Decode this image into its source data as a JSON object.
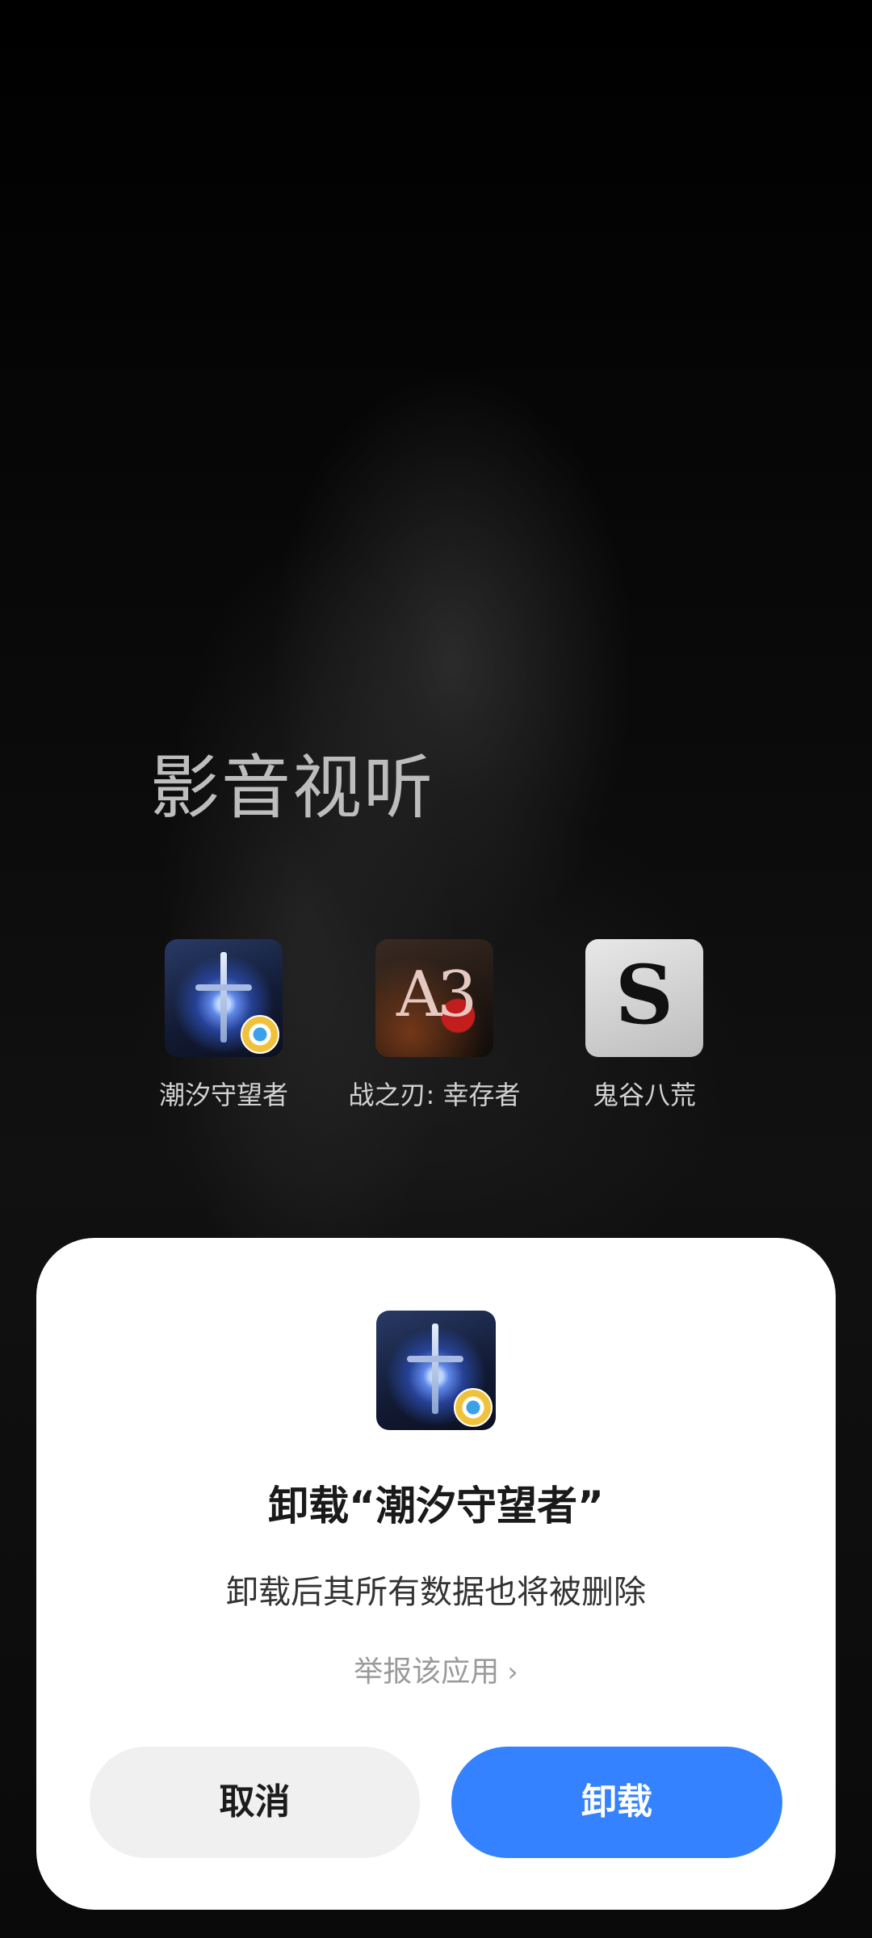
{
  "folder": {
    "title": "影音视听"
  },
  "apps": [
    {
      "label": "潮汐守望者",
      "icon": "tide-watcher-app-icon"
    },
    {
      "label": "战之刃: 幸存者",
      "icon": "a3-app-icon"
    },
    {
      "label": "鬼谷八荒",
      "icon": "ghost-valley-app-icon"
    }
  ],
  "dialog": {
    "title": "卸载“潮汐守望者”",
    "message": "卸载后其所有数据也将被删除",
    "report_label": "举报该应用",
    "report_icon": "chevron-right-icon",
    "cancel_label": "取消",
    "confirm_label": "卸载",
    "confirm_color": "#3482ff"
  },
  "icon_marks": {
    "a3": "A3",
    "ghost": "S"
  }
}
